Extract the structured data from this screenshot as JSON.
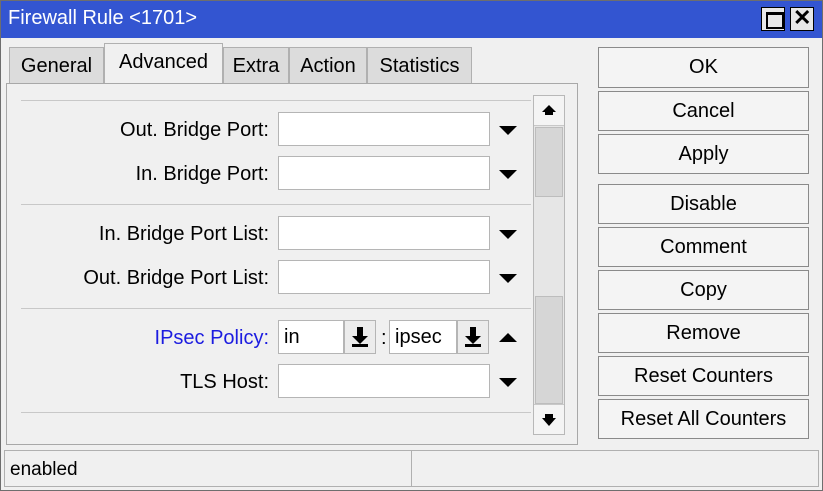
{
  "window": {
    "title": "Firewall Rule <1701>"
  },
  "titlebar": {
    "maximize_icon": "maximize-icon",
    "close_glyph": "✕"
  },
  "tabs": [
    {
      "label": "General",
      "active": false
    },
    {
      "label": "Advanced",
      "active": true
    },
    {
      "label": "Extra",
      "active": false
    },
    {
      "label": "Action",
      "active": false
    },
    {
      "label": "Statistics",
      "active": false
    }
  ],
  "form": {
    "out_bridge_port": {
      "label": "Out. Bridge Port:",
      "value": ""
    },
    "in_bridge_port": {
      "label": "In. Bridge Port:",
      "value": ""
    },
    "in_bridge_port_list": {
      "label": "In. Bridge Port List:",
      "value": ""
    },
    "out_bridge_port_list": {
      "label": "Out. Bridge Port List:",
      "value": ""
    },
    "ipsec_policy": {
      "label": "IPsec Policy:",
      "direction": "in",
      "separator": ":",
      "policy": "ipsec",
      "label_color": "#1c1ce0"
    },
    "tls_host": {
      "label": "TLS Host:",
      "value": ""
    }
  },
  "buttons": {
    "ok": "OK",
    "cancel": "Cancel",
    "apply": "Apply",
    "disable": "Disable",
    "comment": "Comment",
    "copy": "Copy",
    "remove": "Remove",
    "reset_counters": "Reset Counters",
    "reset_all_counters": "Reset All Counters"
  },
  "status": {
    "left": "enabled",
    "right": ""
  },
  "colors": {
    "titlebar": "#3355d1",
    "background": "#f0f0f0"
  }
}
